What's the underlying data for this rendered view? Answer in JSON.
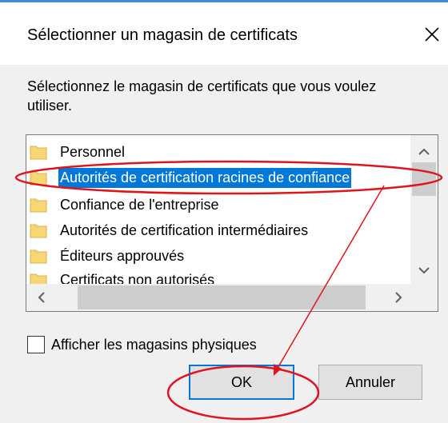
{
  "dialog": {
    "title": "Sélectionner un magasin de certificats",
    "close_icon": "close-icon",
    "instruction": "Sélectionnez le magasin de certificats que vous voulez utiliser."
  },
  "store_list": {
    "items": [
      {
        "label": "Personnel",
        "icon": "folder-icon",
        "selected": false
      },
      {
        "label": "Autorités de certification racines de confiance",
        "icon": "folder-icon",
        "selected": true
      },
      {
        "label": "Confiance de l'entreprise",
        "icon": "folder-icon",
        "selected": false
      },
      {
        "label": "Autorités de certification intermédiaires",
        "icon": "folder-icon",
        "selected": false
      },
      {
        "label": "Éditeurs approuvés",
        "icon": "folder-icon",
        "selected": false
      },
      {
        "label": "Certificats non autorisés",
        "icon": "folder-icon",
        "selected": false
      }
    ]
  },
  "checkbox": {
    "label": "Afficher les magasins physiques",
    "checked": false
  },
  "buttons": {
    "ok": "OK",
    "cancel": "Annuler"
  },
  "colors": {
    "selection": "#0078d7",
    "annotation": "#e0141e",
    "accent_line": "#3b8ae0"
  }
}
